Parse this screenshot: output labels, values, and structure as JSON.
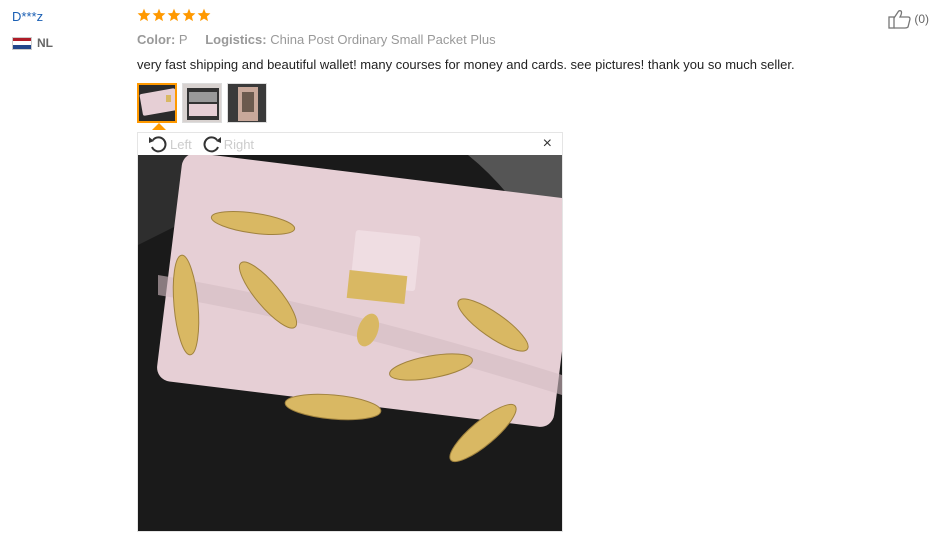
{
  "reviewer": {
    "name": "D***z",
    "country": "NL"
  },
  "rating": {
    "stars": 5
  },
  "meta": {
    "color_label": "Color:",
    "color_value": "P",
    "logistics_label": "Logistics:",
    "logistics_value": "China Post Ordinary Small Packet Plus"
  },
  "review_text": "very fast shipping and beautiful wallet! many courses for money and cards. see pictures! thank you so much seller.",
  "helpful": {
    "count": "(0)"
  },
  "viewer": {
    "rotate_left": "Left",
    "rotate_right": "Right",
    "close": "×"
  },
  "colors": {
    "star": "#f90",
    "accent": "#f90",
    "wallet": "#e6cfd5",
    "leaf": "#d9b863"
  }
}
